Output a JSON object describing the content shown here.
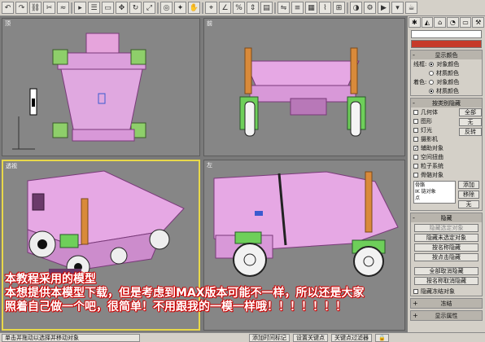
{
  "toolbar": {
    "icons": [
      "undo-icon",
      "redo-icon",
      "link-icon",
      "unlink-icon",
      "bind-space-warp-icon",
      "select-object-icon",
      "select-by-name-icon",
      "select-region-icon",
      "select-move-icon",
      "select-rotate-icon",
      "select-scale-icon",
      "reference-coordinate-icon",
      "pivot-icon",
      "select-manipulate-icon",
      "snap-toggle-icon",
      "angle-snap-icon",
      "percent-snap-icon",
      "spinner-snap-icon",
      "named-selection-icon",
      "mirror-icon",
      "align-icon",
      "layer-manager-icon",
      "curve-editor-icon",
      "schematic-view-icon",
      "material-editor-icon",
      "render-setup-icon",
      "quick-render-icon",
      "render-type-icon",
      "teapot-render-icon"
    ]
  },
  "viewports": [
    {
      "id": "top",
      "label": "顶"
    },
    {
      "id": "front",
      "label": "前"
    },
    {
      "id": "perspective",
      "label": "透视"
    },
    {
      "id": "left",
      "label": "左"
    }
  ],
  "panel": {
    "tabs": [
      "create-tab-icon",
      "modify-tab-icon",
      "hierarchy-tab-icon",
      "motion-tab-icon",
      "display-tab-icon",
      "utilities-tab-icon"
    ],
    "display_color": {
      "title": "显示颜色",
      "wireframe_label": "线框:",
      "shaded_label": "着色:",
      "options": [
        "对象颜色",
        "材质颜色"
      ]
    },
    "hide_by_category": {
      "title": "按类别隐藏",
      "items": [
        {
          "label": "几何体",
          "checked": false
        },
        {
          "label": "图形",
          "checked": false
        },
        {
          "label": "灯光",
          "checked": false
        },
        {
          "label": "摄影机",
          "checked": false
        },
        {
          "label": "辅助对象",
          "checked": true
        },
        {
          "label": "空间扭曲",
          "checked": false
        },
        {
          "label": "粒子系统",
          "checked": false
        },
        {
          "label": "骨骼对象",
          "checked": false
        }
      ],
      "btn_all": "全部",
      "btn_none": "无",
      "btn_invert": "反转",
      "list_text": "骨骼\nIK 链对象\n点",
      "btn_add": "添加",
      "btn_remove": "移除",
      "btn_none2": "无"
    },
    "hide": {
      "title": "隐藏",
      "buttons": [
        {
          "label": "隐藏选定对象",
          "disabled": true
        },
        {
          "label": "隐藏未选定对象",
          "disabled": false
        },
        {
          "label": "按名称隐藏",
          "disabled": false
        },
        {
          "label": "按点击隐藏",
          "disabled": false
        },
        {
          "label": "全部取消隐藏",
          "disabled": false
        },
        {
          "label": "按名称取消隐藏",
          "disabled": false
        }
      ],
      "frozen_label": "隐藏冻结对象"
    },
    "freeze": {
      "title": "冻结"
    },
    "display_props": {
      "title": "显示属性"
    }
  },
  "status": {
    "prompt": "单击并拖动以选择并移动对象",
    "add_time_tag": "添加时间标记",
    "set_key": "设置关键点",
    "key_filters": "关键点过滤器",
    "lock_icon": "lock-icon"
  },
  "caption": {
    "line1": "本教程采用的模型",
    "line2": "本想提供本模型下载，但是考虑到MAX版本可能不一样，所以还是大家",
    "line3": "照着自己做一个吧，很简单！不用跟我的一模一样哦！！！！！！！"
  }
}
